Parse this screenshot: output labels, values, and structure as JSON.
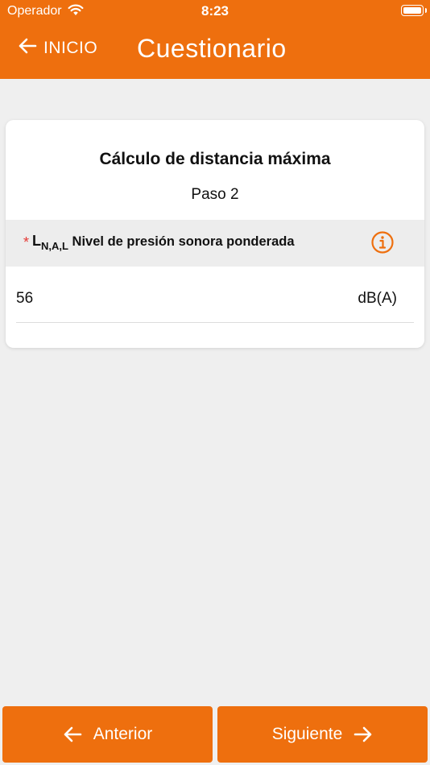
{
  "status_bar": {
    "carrier": "Operador",
    "time": "8:23"
  },
  "header": {
    "back_label": "INICIO",
    "title": "Cuestionario"
  },
  "card": {
    "title": "Cálculo de distancia máxima",
    "step": "Paso 2",
    "field": {
      "required_mark": "*",
      "symbol": "L",
      "symbol_subscript": "N,A,L",
      "label": "Nivel de presión sonora ponderada",
      "value": "56",
      "unit": "dB(A)"
    }
  },
  "footer": {
    "prev_label": "Anterior",
    "next_label": "Siguiente"
  },
  "colors": {
    "accent": "#ee6f0e",
    "background": "#efefef",
    "required": "#e53935"
  }
}
